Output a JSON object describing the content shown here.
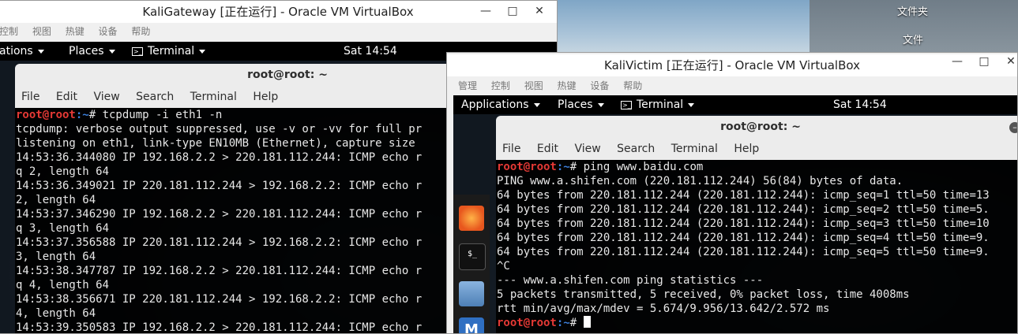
{
  "desktop": {
    "icon_labels": [
      "文件夹",
      "文件"
    ]
  },
  "gateway": {
    "title": "KaliGateway [正在运行] - Oracle VM VirtualBox",
    "vbox_menu": [
      "控制",
      "视图",
      "热键",
      "设备",
      "帮助"
    ],
    "topbar": {
      "applications": "ations",
      "places": "Places",
      "terminal": "Terminal",
      "clock": "Sat 14:54"
    },
    "terminal": {
      "title": "root@root: ~",
      "menu": [
        "File",
        "Edit",
        "View",
        "Search",
        "Terminal",
        "Help"
      ],
      "prompt_user": "root@root",
      "prompt_path": ":~",
      "prompt_symbol": "# ",
      "command": "tcpdump -i eth1 -n",
      "lines": [
        "tcpdump: verbose output suppressed, use -v or -vv for full pr",
        "listening on eth1, link-type EN10MB (Ethernet), capture size",
        "14:53:36.344080 IP 192.168.2.2 > 220.181.112.244: ICMP echo r",
        "q 2, length 64",
        "14:53:36.349021 IP 220.181.112.244 > 192.168.2.2: ICMP echo r",
        "2, length 64",
        "14:53:37.346290 IP 192.168.2.2 > 220.181.112.244: ICMP echo r",
        "q 3, length 64",
        "14:53:37.356588 IP 220.181.112.244 > 192.168.2.2: ICMP echo r",
        "3, length 64",
        "14:53:38.347787 IP 192.168.2.2 > 220.181.112.244: ICMP echo r",
        "q 4, length 64",
        "14:53:38.356671 IP 220.181.112.244 > 192.168.2.2: ICMP echo r",
        "4, length 64",
        "14:53:39.350583 IP 192.168.2.2 > 220.181.112.244: ICMP echo r"
      ]
    }
  },
  "victim": {
    "title": "KaliVictim [正在运行] - Oracle VM VirtualBox",
    "vbox_menu": [
      "管理",
      "控制",
      "视图",
      "热键",
      "设备",
      "帮助"
    ],
    "topbar": {
      "applications": "Applications",
      "places": "Places",
      "terminal": "Terminal",
      "clock": "Sat 14:54"
    },
    "dock_icons": [
      "firefox-icon",
      "terminal-app-icon",
      "files-icon",
      "mail-icon"
    ],
    "terminal": {
      "title": "root@root: ~",
      "menu": [
        "File",
        "Edit",
        "View",
        "Search",
        "Terminal",
        "Help"
      ],
      "prompt_user": "root@root",
      "prompt_path": ":~",
      "prompt_symbol": "# ",
      "command": "ping www.baidu.com",
      "lines": [
        "PING www.a.shifen.com (220.181.112.244) 56(84) bytes of data.",
        "64 bytes from 220.181.112.244 (220.181.112.244): icmp_seq=1 ttl=50 time=13",
        "64 bytes from 220.181.112.244 (220.181.112.244): icmp_seq=2 ttl=50 time=5.",
        "64 bytes from 220.181.112.244 (220.181.112.244): icmp_seq=3 ttl=50 time=10",
        "64 bytes from 220.181.112.244 (220.181.112.244): icmp_seq=4 ttl=50 time=9.",
        "64 bytes from 220.181.112.244 (220.181.112.244): icmp_seq=5 ttl=50 time=9.",
        "^C",
        "--- www.a.shifen.com ping statistics ---",
        "5 packets transmitted, 5 received, 0% packet loss, time 4008ms",
        "rtt min/avg/max/mdev = 5.674/9.956/13.642/2.572 ms"
      ]
    }
  },
  "colors": {
    "prompt_user": "#e53935",
    "prompt_path": "#3b7dd8"
  }
}
